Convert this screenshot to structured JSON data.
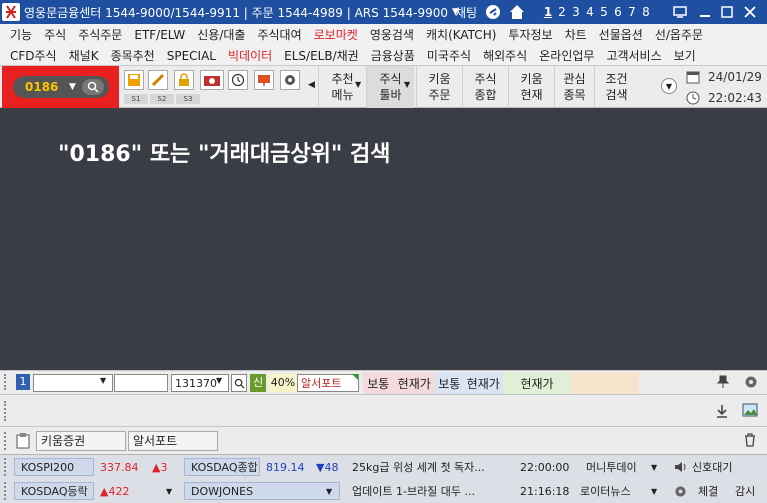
{
  "titlebar": {
    "title": "영웅문금융센터 1544-9000/1544-9911 | 주문 1544-4989 | ARS 1544-9900",
    "chat_label": "채팅",
    "screen_numbers": [
      "1",
      "2",
      "3",
      "4",
      "5",
      "6",
      "7",
      "8"
    ],
    "active_screen": "1",
    "icons": [
      "heroes-logo-icon",
      "chevron-down-icon",
      "chat-icon",
      "home-icon",
      "monitor-icon",
      "minimize-icon",
      "maximize-icon",
      "close-icon"
    ]
  },
  "menu": {
    "row1": [
      "기능",
      "주식",
      "주식주문",
      "ETF/ELW",
      "신용/대출",
      "주식대여",
      "로보마켓",
      "영웅검색",
      "캐치(KATCH)",
      "투자정보",
      "차트",
      "선물옵션",
      "선/옵주문"
    ],
    "row2": [
      "CFD주식",
      "채널K",
      "종목추천",
      "SPECIAL",
      "빅데이터",
      "ELS/ELB/채권",
      "금융상품",
      "미국주식",
      "해외주식",
      "온라인업무",
      "고객서비스",
      "보기"
    ],
    "red_items": [
      "로보마켓",
      "빅데이터"
    ]
  },
  "toolbar": {
    "screen_code": "0186",
    "slot_labels": [
      "S1",
      "S2",
      "S3"
    ],
    "buttons": [
      {
        "line1": "추천",
        "line2": "메뉴"
      },
      {
        "line1": "주식",
        "line2": "툴바"
      },
      {
        "line1": "키움",
        "line2": "주문"
      },
      {
        "line1": "주식",
        "line2": "종합"
      },
      {
        "line1": "키움",
        "line2": "현재"
      },
      {
        "line1": "관심",
        "line2": "종목"
      },
      {
        "line1": "조건",
        "line2": "검색"
      }
    ],
    "date": "24/01/29",
    "time": "22:02:43"
  },
  "main": {
    "instruction": "\"0186\" 또는 \"거래대금상위\" 검색"
  },
  "bottom": {
    "slot_number": "1",
    "code_input": "131370",
    "badge_new": "신",
    "percent": "40%",
    "stock_name": "알서포트",
    "cells": [
      "보통",
      "현재가",
      "보통",
      "현재가",
      "현재가"
    ]
  },
  "favorites": {
    "broker": "키움증권",
    "stock": "알서포트"
  },
  "ticker": {
    "row1": {
      "index1_name": "KOSPI200",
      "index1_value": "337.84",
      "index1_change": "▲3",
      "index2_name": "KOSDAQ종합",
      "index2_value": "819.14",
      "index2_change": "▼48",
      "news": "25kg급 위성 세계 첫 독자...",
      "news_time": "22:00:00",
      "news_source": "머니투데이",
      "signal_label": "신호대기"
    },
    "row2": {
      "name1": "KOSDAQ등락",
      "value1": "▲422",
      "name2": "DOWJONES",
      "news": "업데이트 1-브라질 대두 ...",
      "news_time": "21:16:18",
      "news_source": "로이터뉴스",
      "btn1": "체결",
      "btn2": "감시"
    }
  },
  "colors": {
    "titlebar": "#1f4fa0",
    "main_bg": "#3a3d45",
    "accent_red": "#e82020",
    "code_yellow": "#ffc400",
    "up_red": "#e0232b",
    "down_blue": "#1f3fbf"
  }
}
